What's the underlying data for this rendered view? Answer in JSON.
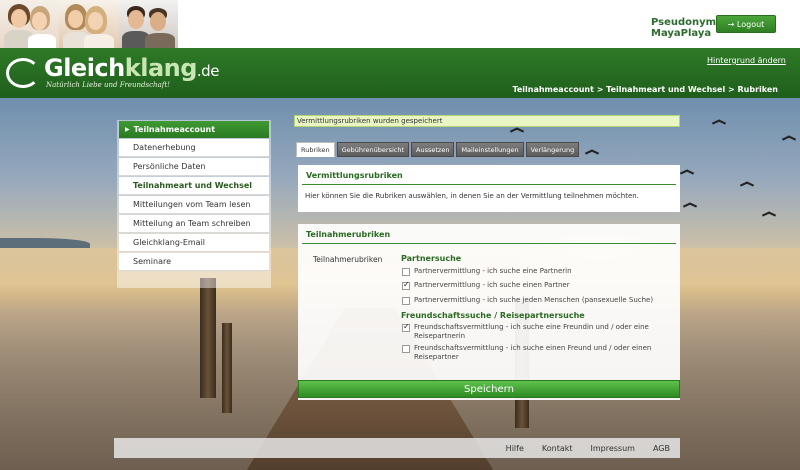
{
  "header": {
    "pseudo_label": "Pseudonym",
    "username": "MayaPlaya",
    "logout_label": "→ Logout"
  },
  "brand": {
    "logo_main": "Gleich",
    "logo_accent": "klang",
    "logo_tld": ".de",
    "slogan": "Natürlich Liebe und Freundschaft!",
    "background_link": "Hintergrund ändern"
  },
  "breadcrumb": "Teilnahmeaccount > Teilnahmeart und Wechsel > Rubriken",
  "sidebar": {
    "heading": "Teilnahmeaccount",
    "items": [
      {
        "label": "Datenerhebung"
      },
      {
        "label": "Persönliche Daten"
      },
      {
        "label": "Teilnahmeart und Wechsel"
      },
      {
        "label": "Mitteilungen vom Team lesen"
      },
      {
        "label": "Mitteilung an Team schreiben"
      },
      {
        "label": "Gleichklang-Email"
      },
      {
        "label": "Seminare"
      }
    ]
  },
  "notice": "Vermittlungsrubriken wurden gespeichert",
  "tabs": [
    {
      "label": "Rubriken"
    },
    {
      "label": "Gebührenübersicht"
    },
    {
      "label": "Aussetzen"
    },
    {
      "label": "Maileinstellungen"
    },
    {
      "label": "Verlängerung"
    }
  ],
  "intro_panel": {
    "title": "Vermittlungsrubriken",
    "description": "Hier können Sie die Rubriken auswählen, in denen Sie an der Vermittlung teilnehmen möchten."
  },
  "rubric_panel": {
    "title": "Teilnahmerubriken",
    "row_label": "Teilnahmerubriken",
    "group1_title": "Partnersuche",
    "group1_options": [
      {
        "label": "Partnervermittlung - ich suche eine Partnerin",
        "checked": false
      },
      {
        "label": "Partnervermittlung - ich suche einen Partner",
        "checked": true
      },
      {
        "label": "Partnervermittlung - ich suche jeden Menschen (pansexuelle Suche)",
        "checked": false
      }
    ],
    "group2_title": "Freundschaftssuche / Reisepartnersuche",
    "group2_options": [
      {
        "label": "Freundschaftsvermittlung - ich suche eine Freundin und / oder eine Reisepartnerin",
        "checked": true
      },
      {
        "label": "Freundschaftsvermittlung - ich suche einen Freund und / oder einen Reisepartner",
        "checked": false
      }
    ],
    "save_label": "Speichern"
  },
  "footer": {
    "links": [
      {
        "label": "Hilfe"
      },
      {
        "label": "Kontakt"
      },
      {
        "label": "Impressum"
      },
      {
        "label": "AGB"
      }
    ]
  }
}
